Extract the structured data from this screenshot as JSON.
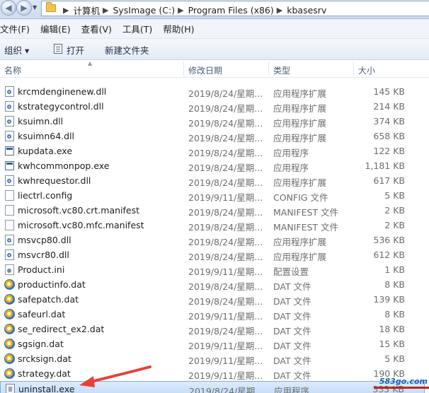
{
  "address": {
    "crumbs": [
      "计算机",
      "SysImage (C:)",
      "Program Files (x86)",
      "kbasesrv"
    ]
  },
  "menu": [
    "文件(F)",
    "编辑(E)",
    "查看(V)",
    "工具(T)",
    "帮助(H)"
  ],
  "toolbar": {
    "organize_label": "组织 ▾",
    "open_label": "打开",
    "new_folder_label": "新建文件夹"
  },
  "columns": {
    "name": "名称",
    "date": "修改日期",
    "type": "类型",
    "size": "大小"
  },
  "files": [
    {
      "name": "krcmdenginenew.dll",
      "date": "2019/8/24/星期...",
      "type": "应用程序扩展",
      "size": "145 KB",
      "icon": "dll"
    },
    {
      "name": "kstrategycontrol.dll",
      "date": "2019/8/24/星期...",
      "type": "应用程序扩展",
      "size": "214 KB",
      "icon": "dll"
    },
    {
      "name": "ksuimn.dll",
      "date": "2019/8/24/星期...",
      "type": "应用程序扩展",
      "size": "374 KB",
      "icon": "dll"
    },
    {
      "name": "ksuimn64.dll",
      "date": "2019/8/24/星期...",
      "type": "应用程序扩展",
      "size": "658 KB",
      "icon": "dll"
    },
    {
      "name": "kupdata.exe",
      "date": "2019/8/24/星期...",
      "type": "应用程序",
      "size": "122 KB",
      "icon": "exe"
    },
    {
      "name": "kwhcommonpop.exe",
      "date": "2019/8/24/星期...",
      "type": "应用程序",
      "size": "1,181 KB",
      "icon": "exe"
    },
    {
      "name": "kwhrequestor.dll",
      "date": "2019/8/24/星期...",
      "type": "应用程序扩展",
      "size": "617 KB",
      "icon": "dll"
    },
    {
      "name": "liectrl.config",
      "date": "2019/9/11/星期...",
      "type": "CONFIG 文件",
      "size": "5 KB",
      "icon": "doc"
    },
    {
      "name": "microsoft.vc80.crt.manifest",
      "date": "2019/8/24/星期...",
      "type": "MANIFEST 文件",
      "size": "2 KB",
      "icon": "doc"
    },
    {
      "name": "microsoft.vc80.mfc.manifest",
      "date": "2019/8/24/星期...",
      "type": "MANIFEST 文件",
      "size": "2 KB",
      "icon": "doc"
    },
    {
      "name": "msvcp80.dll",
      "date": "2019/8/24/星期...",
      "type": "应用程序扩展",
      "size": "536 KB",
      "icon": "dll"
    },
    {
      "name": "msvcr80.dll",
      "date": "2019/8/24/星期...",
      "type": "应用程序扩展",
      "size": "612 KB",
      "icon": "dll"
    },
    {
      "name": "Product.ini",
      "date": "2019/9/11/星期...",
      "type": "配置设置",
      "size": "1 KB",
      "icon": "ini"
    },
    {
      "name": "productinfo.dat",
      "date": "2019/8/24/星期...",
      "type": "DAT 文件",
      "size": "8 KB",
      "icon": "dat"
    },
    {
      "name": "safepatch.dat",
      "date": "2019/8/24/星期...",
      "type": "DAT 文件",
      "size": "139 KB",
      "icon": "dat"
    },
    {
      "name": "safeurl.dat",
      "date": "2019/9/11/星期...",
      "type": "DAT 文件",
      "size": "8 KB",
      "icon": "dat"
    },
    {
      "name": "se_redirect_ex2.dat",
      "date": "2019/8/24/星期...",
      "type": "DAT 文件",
      "size": "18 KB",
      "icon": "dat"
    },
    {
      "name": "sgsign.dat",
      "date": "2019/9/11/星期...",
      "type": "DAT 文件",
      "size": "15 KB",
      "icon": "dat"
    },
    {
      "name": "srcksign.dat",
      "date": "2019/9/11/星期...",
      "type": "DAT 文件",
      "size": "5 KB",
      "icon": "dat"
    },
    {
      "name": "strategy.dat",
      "date": "2019/9/11/星期...",
      "type": "DAT 文件",
      "size": "190 KB",
      "icon": "dat"
    },
    {
      "name": "uninstall.exe",
      "date": "2019/8/24/星期...",
      "type": "应用程序",
      "size": "333 KB",
      "icon": "uninst",
      "selected": true
    }
  ],
  "watermark": "583go.com",
  "colors": {
    "selection_bg": "#cfe3fb",
    "annotation_arrow": "#e8413a",
    "watermark": "#1a62b5"
  }
}
